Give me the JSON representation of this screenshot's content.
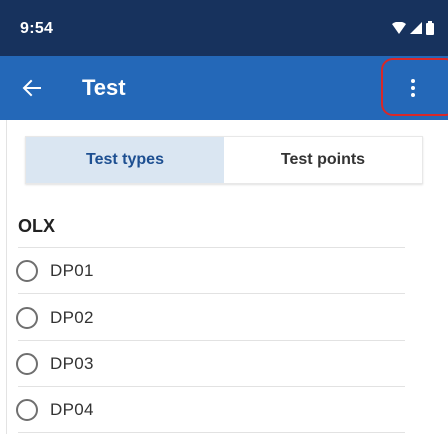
{
  "status_bar": {
    "time": "9:54",
    "icons": [
      "wifi-icon",
      "cellular-signal-icon",
      "battery-icon"
    ]
  },
  "app_bar": {
    "title": "Test",
    "back_icon": "arrow-back-icon",
    "menu_icon": "more-vertical-icon"
  },
  "tabs": [
    {
      "label": "Test types",
      "active": true
    },
    {
      "label": "Test points",
      "active": false
    }
  ],
  "section": {
    "title": "OLX",
    "options": [
      {
        "label": "DP01",
        "selected": false
      },
      {
        "label": "DP02",
        "selected": false
      },
      {
        "label": "DP03",
        "selected": false
      },
      {
        "label": "DP04",
        "selected": false
      }
    ]
  },
  "colors": {
    "status_bar_bg": "#17325d",
    "app_bar_bg": "#2468b8",
    "active_tab_bg": "#dae6f2",
    "active_tab_text": "#1d4f91",
    "highlight": "#d92828"
  }
}
